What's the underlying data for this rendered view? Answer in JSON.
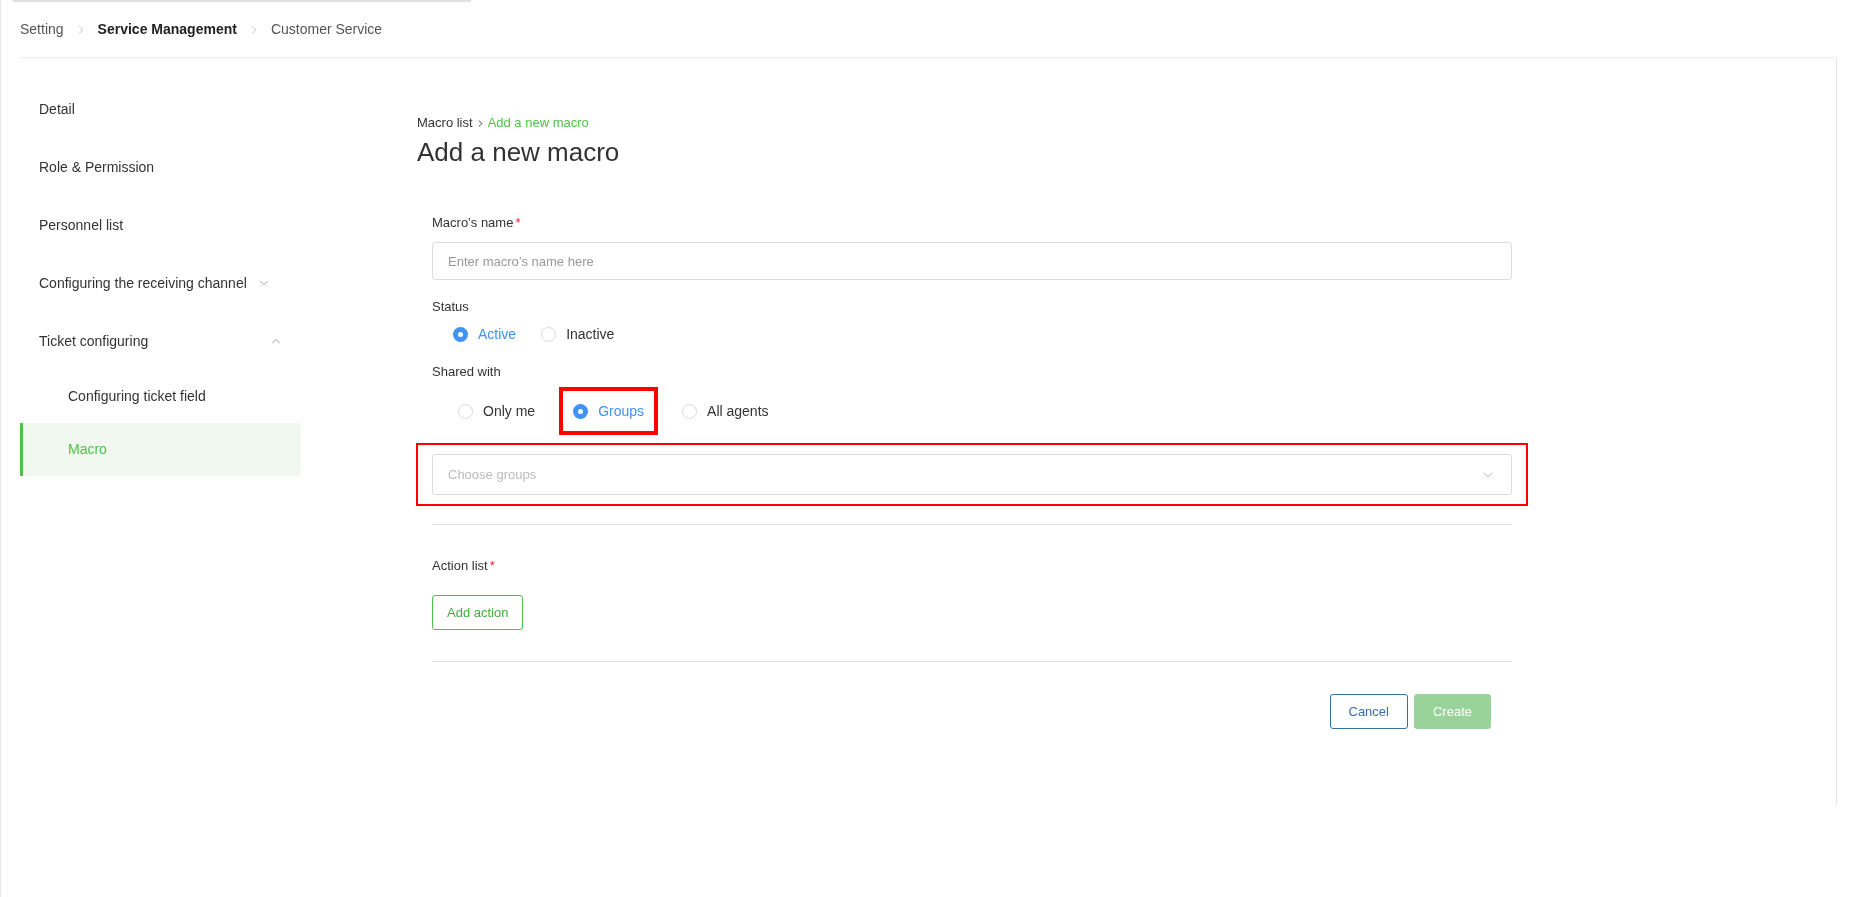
{
  "breadcrumb": [
    {
      "label": "Setting",
      "current": false
    },
    {
      "label": "Service Management",
      "current": true
    },
    {
      "label": "Customer Service",
      "current": false
    }
  ],
  "sidebar": {
    "items": [
      {
        "label": "Detail",
        "selected": false
      },
      {
        "label": "Role & Permission",
        "selected": false
      },
      {
        "label": "Personnel list",
        "selected": false
      },
      {
        "label": "Configuring the receiving channel",
        "selected": false,
        "expanded": false
      },
      {
        "label": "Ticket configuring",
        "selected": false,
        "expanded": true,
        "children": [
          {
            "label": "Configuring ticket field",
            "selected": false
          },
          {
            "label": "Macro",
            "selected": true
          }
        ]
      }
    ]
  },
  "page_breadcrumb": [
    {
      "label": "Macro list",
      "current": false
    },
    {
      "label": "Add a new macro",
      "current": true
    }
  ],
  "title": "Add a new macro",
  "name_field": {
    "label": "Macro’s name",
    "required_mark": "*",
    "placeholder": "Enter macro’s name here"
  },
  "status": {
    "label": "Status",
    "options": [
      {
        "label": "Active",
        "selected": true
      },
      {
        "label": "Inactive",
        "selected": false
      }
    ]
  },
  "shared_with": {
    "label": "Shared with",
    "options": [
      {
        "label": "Only me",
        "selected": false,
        "highlighted": false
      },
      {
        "label": "Groups",
        "selected": true,
        "highlighted": true
      },
      {
        "label": "All agents",
        "selected": false,
        "highlighted": false
      }
    ]
  },
  "groups_select": {
    "placeholder": "Choose groups",
    "highlighted": true
  },
  "action_list": {
    "label": "Action list",
    "required_mark": "*",
    "button": "Add action"
  },
  "buttons": [
    {
      "kind": "secondary",
      "label": "Cancel",
      "disabled": false
    },
    {
      "kind": "primary",
      "label": "Create",
      "disabled": true
    }
  ]
}
